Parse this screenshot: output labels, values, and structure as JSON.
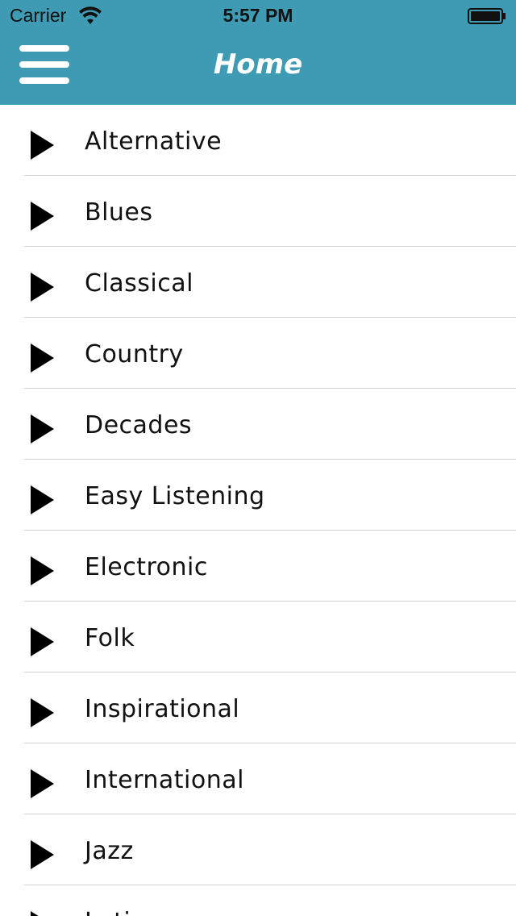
{
  "status_bar": {
    "carrier": "Carrier",
    "time": "5:57 PM"
  },
  "header": {
    "title": "Home",
    "background_color": "#3e9bb3",
    "menu_icon": "hamburger-menu-icon"
  },
  "genres": [
    {
      "label": "Alternative",
      "icon": "play-icon"
    },
    {
      "label": "Blues",
      "icon": "play-icon"
    },
    {
      "label": "Classical",
      "icon": "play-icon"
    },
    {
      "label": "Country",
      "icon": "play-icon"
    },
    {
      "label": "Decades",
      "icon": "play-icon"
    },
    {
      "label": "Easy Listening",
      "icon": "play-icon"
    },
    {
      "label": "Electronic",
      "icon": "play-icon"
    },
    {
      "label": "Folk",
      "icon": "play-icon"
    },
    {
      "label": "Inspirational",
      "icon": "play-icon"
    },
    {
      "label": "International",
      "icon": "play-icon"
    },
    {
      "label": "Jazz",
      "icon": "play-icon"
    },
    {
      "label": "Latin",
      "icon": "play-icon"
    }
  ]
}
